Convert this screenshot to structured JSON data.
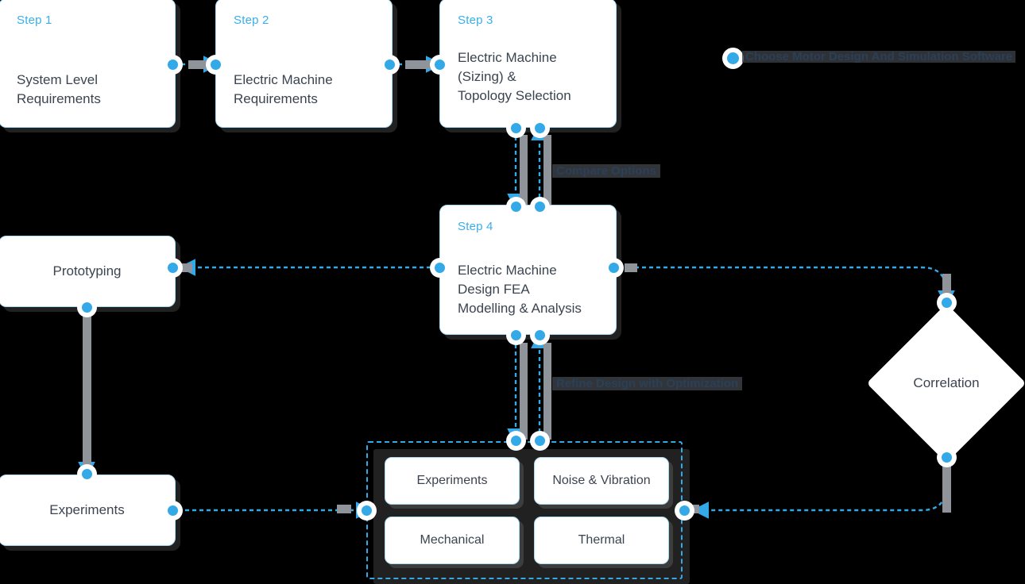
{
  "diagram": {
    "title_banner": {
      "text": "Choose Motor Design And Simulation Software",
      "obscured": true
    },
    "steps": [
      {
        "id": "step1",
        "step_label": "Step 1",
        "title": "System Level\nRequirements"
      },
      {
        "id": "step2",
        "step_label": "Step 2",
        "title": "Electric Machine\nRequirements"
      },
      {
        "id": "step3",
        "step_label": "Step 3",
        "title": "Electric Machine\n(Sizing) &\nTopology Selection"
      },
      {
        "id": "step4",
        "step_label": "Step 4",
        "title": "Electric Machine\nDesign FEA\nModelling & Analysis"
      }
    ],
    "side_nodes": [
      {
        "id": "prototyping",
        "label": "Prototyping"
      },
      {
        "id": "experiments",
        "label": "Experiments"
      }
    ],
    "decision": {
      "id": "correlation",
      "label": "Correlation"
    },
    "analysis_group": {
      "cells": [
        {
          "id": "cell-experiments",
          "label": "Experiments"
        },
        {
          "id": "cell-noise-vibration",
          "label": "Noise & Vibration"
        },
        {
          "id": "cell-mechanical",
          "label": "Mechanical"
        },
        {
          "id": "cell-thermal",
          "label": "Thermal"
        }
      ]
    },
    "edge_labels": [
      {
        "id": "compare-options",
        "text": "Compare Options",
        "obscured": true
      },
      {
        "id": "refine-design",
        "text": "Refine Design with Optimization",
        "obscured": true
      }
    ],
    "colors": {
      "accent": "#33a9e8",
      "card_border": "#a9dcf4",
      "text": "#3b4450",
      "step_label": "#38afe8",
      "gray_line": "#8e9499",
      "background": "#000000"
    }
  }
}
